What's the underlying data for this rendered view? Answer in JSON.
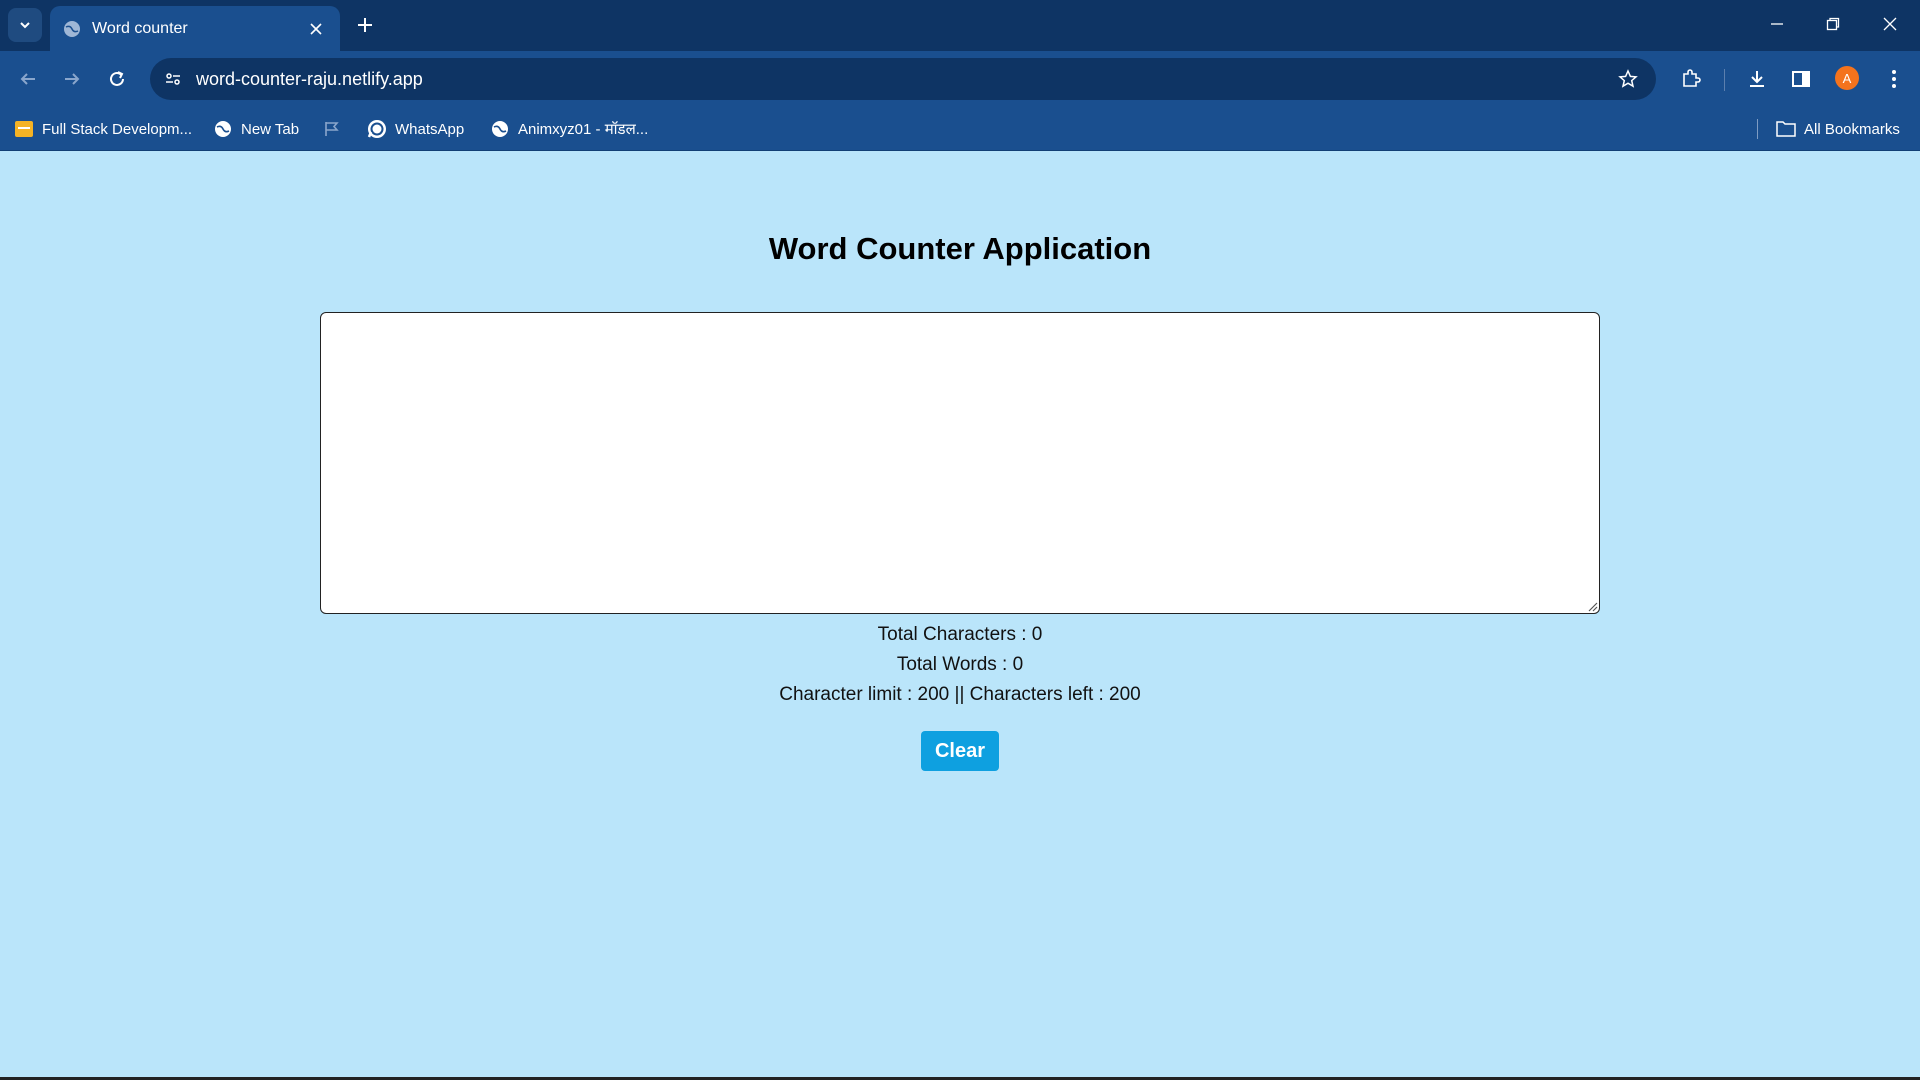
{
  "browser": {
    "tab": {
      "title": "Word counter"
    },
    "url": "word-counter-raju.netlify.app",
    "profile_initial": "A",
    "bookmarks": [
      {
        "label": "Full Stack Developm...",
        "icon": "folder-colored-icon"
      },
      {
        "label": "New Tab",
        "icon": "globe-icon"
      },
      {
        "label": "",
        "icon": "flag-icon"
      },
      {
        "label": "WhatsApp",
        "icon": "whatsapp-icon"
      },
      {
        "label": "Animxyz01 - मॉडल...",
        "icon": "globe-icon"
      }
    ],
    "all_bookmarks_label": "All Bookmarks"
  },
  "app": {
    "title": "Word Counter Application",
    "textarea_value": "",
    "stats": {
      "total_characters": "Total Characters : 0",
      "total_words": "Total Words : 0",
      "limit_line": "Character limit : 200 || Characters left : 200"
    },
    "clear_label": "Clear"
  },
  "colors": {
    "page_background": "#bae5fa",
    "chrome_dark": "#0e3464",
    "chrome_blue": "#1a4f8f",
    "button_blue": "#0ea0e0",
    "avatar_orange": "#f4731d"
  }
}
